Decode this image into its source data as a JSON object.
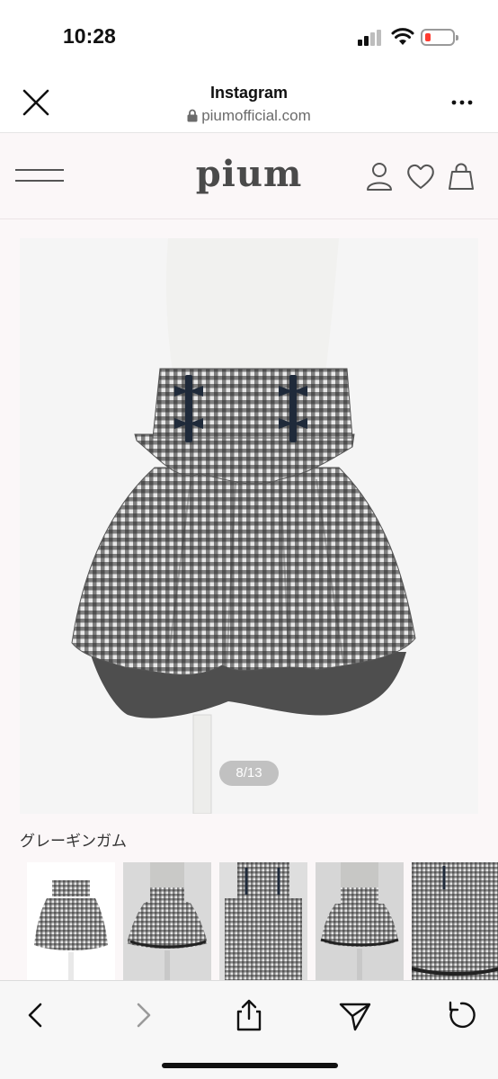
{
  "status_bar": {
    "time": "10:28",
    "signal_icon": "cellular-signal-icon",
    "wifi_icon": "wifi-icon",
    "battery_icon": "battery-low-icon",
    "battery_color": "#ff3b30"
  },
  "browser_header": {
    "title": "Instagram",
    "url": "piumofficial.com",
    "close_icon": "close-icon",
    "lock_icon": "lock-icon",
    "more_icon": "more-dots-icon"
  },
  "site_nav": {
    "logo": "pium",
    "menu_icon": "hamburger-menu-icon",
    "account_icon": "user-icon",
    "favorites_icon": "heart-icon",
    "cart_icon": "shopping-bag-icon",
    "background": "#fbf7f8"
  },
  "product": {
    "image_counter": "8/13",
    "color_name": "グレーギンガム",
    "thumbnail_count": 5
  },
  "toolbar": {
    "back_icon": "chevron-left-icon",
    "forward_icon": "chevron-right-icon",
    "share_icon": "share-icon",
    "send_icon": "send-icon",
    "reload_icon": "reload-icon"
  }
}
